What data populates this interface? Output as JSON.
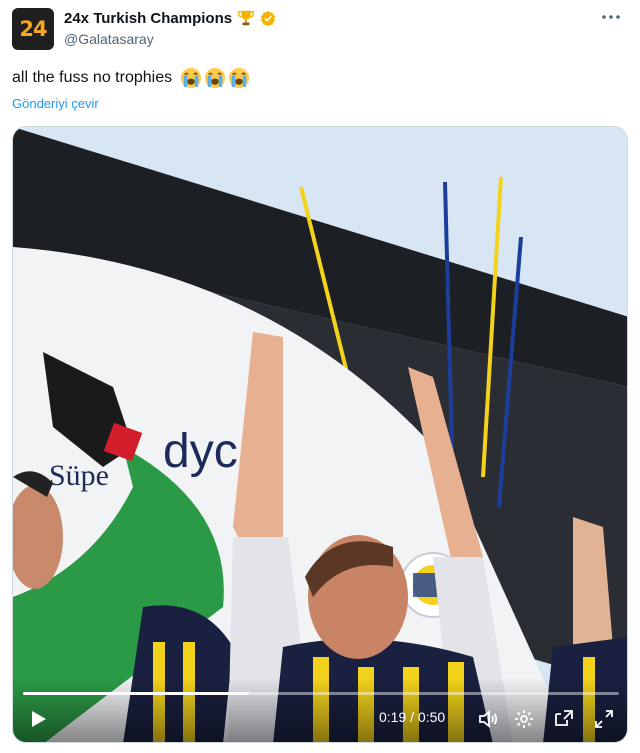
{
  "header": {
    "avatar_text": "24",
    "display_name": "24x Turkish Champions",
    "name_icons": [
      "trophy-icon",
      "verified-badge-icon"
    ],
    "handle": "@Galatasaray",
    "more_icon": "more-horizontal-icon"
  },
  "tweet": {
    "text": "all the fuss no trophies",
    "emoji": [
      "loudly-crying-face",
      "loudly-crying-face",
      "loudly-crying-face"
    ],
    "translate_label": "Gönderiyi çevir"
  },
  "video": {
    "background_text_1": "Süpe",
    "background_text_2": "dyc",
    "time_label": "0:19 / 0:50",
    "progress": 0.38,
    "controls": [
      "play-icon",
      "volume-icon",
      "settings-icon",
      "picture-in-picture-icon",
      "fullscreen-icon"
    ]
  },
  "colors": {
    "link": "#1d9bf0",
    "handle": "#536471",
    "verified": "#f4b400",
    "kit_navy": "#1a2140",
    "kit_yellow": "#f2d21b"
  }
}
